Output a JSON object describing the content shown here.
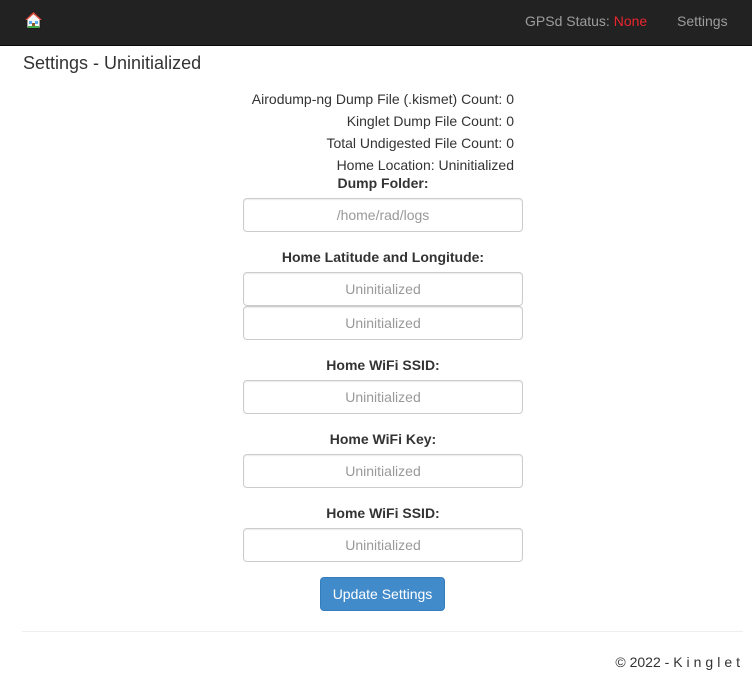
{
  "navbar": {
    "gps_label": "GPSd Status:",
    "gps_value": "None",
    "settings_link": "Settings",
    "colors": {
      "background": "#222222",
      "link": "#9d9d9d",
      "status_none": "#e8262d"
    }
  },
  "page": {
    "title": "Settings - Uninitialized"
  },
  "stats": {
    "airodump": "Airodump-ng Dump File (.kismet) Count: 0",
    "kinglet": "Kinglet Dump File Count: 0",
    "undigested": "Total Undigested File Count: 0",
    "home_location": "Home Location: Uninitialized"
  },
  "form": {
    "dump_folder": {
      "label": "Dump Folder:",
      "placeholder": "/home/rad/logs"
    },
    "home_latlon": {
      "label": "Home Latitude and Longitude:",
      "lat_placeholder": "Uninitialized",
      "lon_placeholder": "Uninitialized"
    },
    "wifi_ssid": {
      "label": "Home WiFi SSID:",
      "placeholder": "Uninitialized"
    },
    "wifi_key": {
      "label": "Home WiFi Key:",
      "placeholder": "Uninitialized"
    },
    "wifi_ssid_2": {
      "label": "Home WiFi SSID:",
      "placeholder": "Uninitialized"
    },
    "submit_label": "Update Settings",
    "submit_color": "#428bca"
  },
  "footer": {
    "copyright": "© 2022 - ",
    "brand": "Kinglet"
  }
}
